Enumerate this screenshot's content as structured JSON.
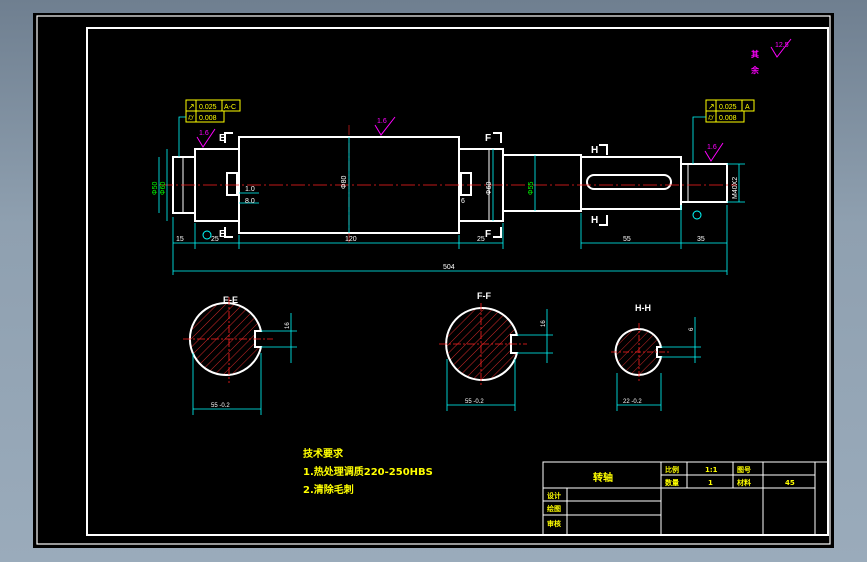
{
  "colors": {
    "background": "#000000",
    "outline": "#ffffff",
    "dimension": "#00ffff",
    "center_line": "#ff2020",
    "tolerance": "#ffff00",
    "roughness": "#ff00ff",
    "notes_text": "#ffff00",
    "hatch": "#ff3030",
    "dim_value": "#00ff00"
  },
  "tolerance_frames": {
    "left_runout": "0.025",
    "left_runout_datum": "A-C",
    "left_cylindricity": "0.008",
    "right_runout": "0.025",
    "right_runout_datum": "A",
    "right_cylindricity": "0.008"
  },
  "roughness": {
    "top_right": "12.5",
    "top_right_note": [
      "其",
      "余"
    ],
    "left": "1.6",
    "middle": "1.6",
    "right": "1.6"
  },
  "dims": {
    "overall": "504",
    "d_main": "Φ80",
    "d_left_journal": "Φ60",
    "d_left_end": "Φ50",
    "d_right_journal": "Φ60",
    "d_right_step": "Φ55",
    "d_right_end": "M40X2",
    "len_main": "120",
    "len_left_end": "15",
    "len_left_journal": "25",
    "len_right_journal": "25",
    "len_key": "55",
    "len_end": "35",
    "small_1": "1.0",
    "small_2": "8.0",
    "small_3": "6"
  },
  "section_labels": {
    "left_top": "E",
    "left_bottom": "E",
    "mid_top": "F",
    "mid_bottom": "F",
    "right_top": "H",
    "right_bottom": "H"
  },
  "sections": [
    {
      "title": "E-E",
      "dim": "55 -0.2",
      "key": "16"
    },
    {
      "title": "F-F",
      "dim": "55 -0.2",
      "key": "16"
    },
    {
      "title": "H-H",
      "dim": "22 -0.2",
      "key": "6"
    }
  ],
  "notes": {
    "heading": "技术要求",
    "lines": [
      "1.热处理调质220-250HBS",
      "2.清除毛刺"
    ]
  },
  "title_block": {
    "part_name": "转轴",
    "scale_label": "比例",
    "scale_value": "1:1",
    "drawing_no_label": "图号",
    "quantity_label": "数量",
    "quantity_value": "1",
    "material_label": "材料",
    "material_value": "45",
    "designer_label": "设计",
    "drafter_label": "绘图",
    "checker_label": "审核"
  }
}
